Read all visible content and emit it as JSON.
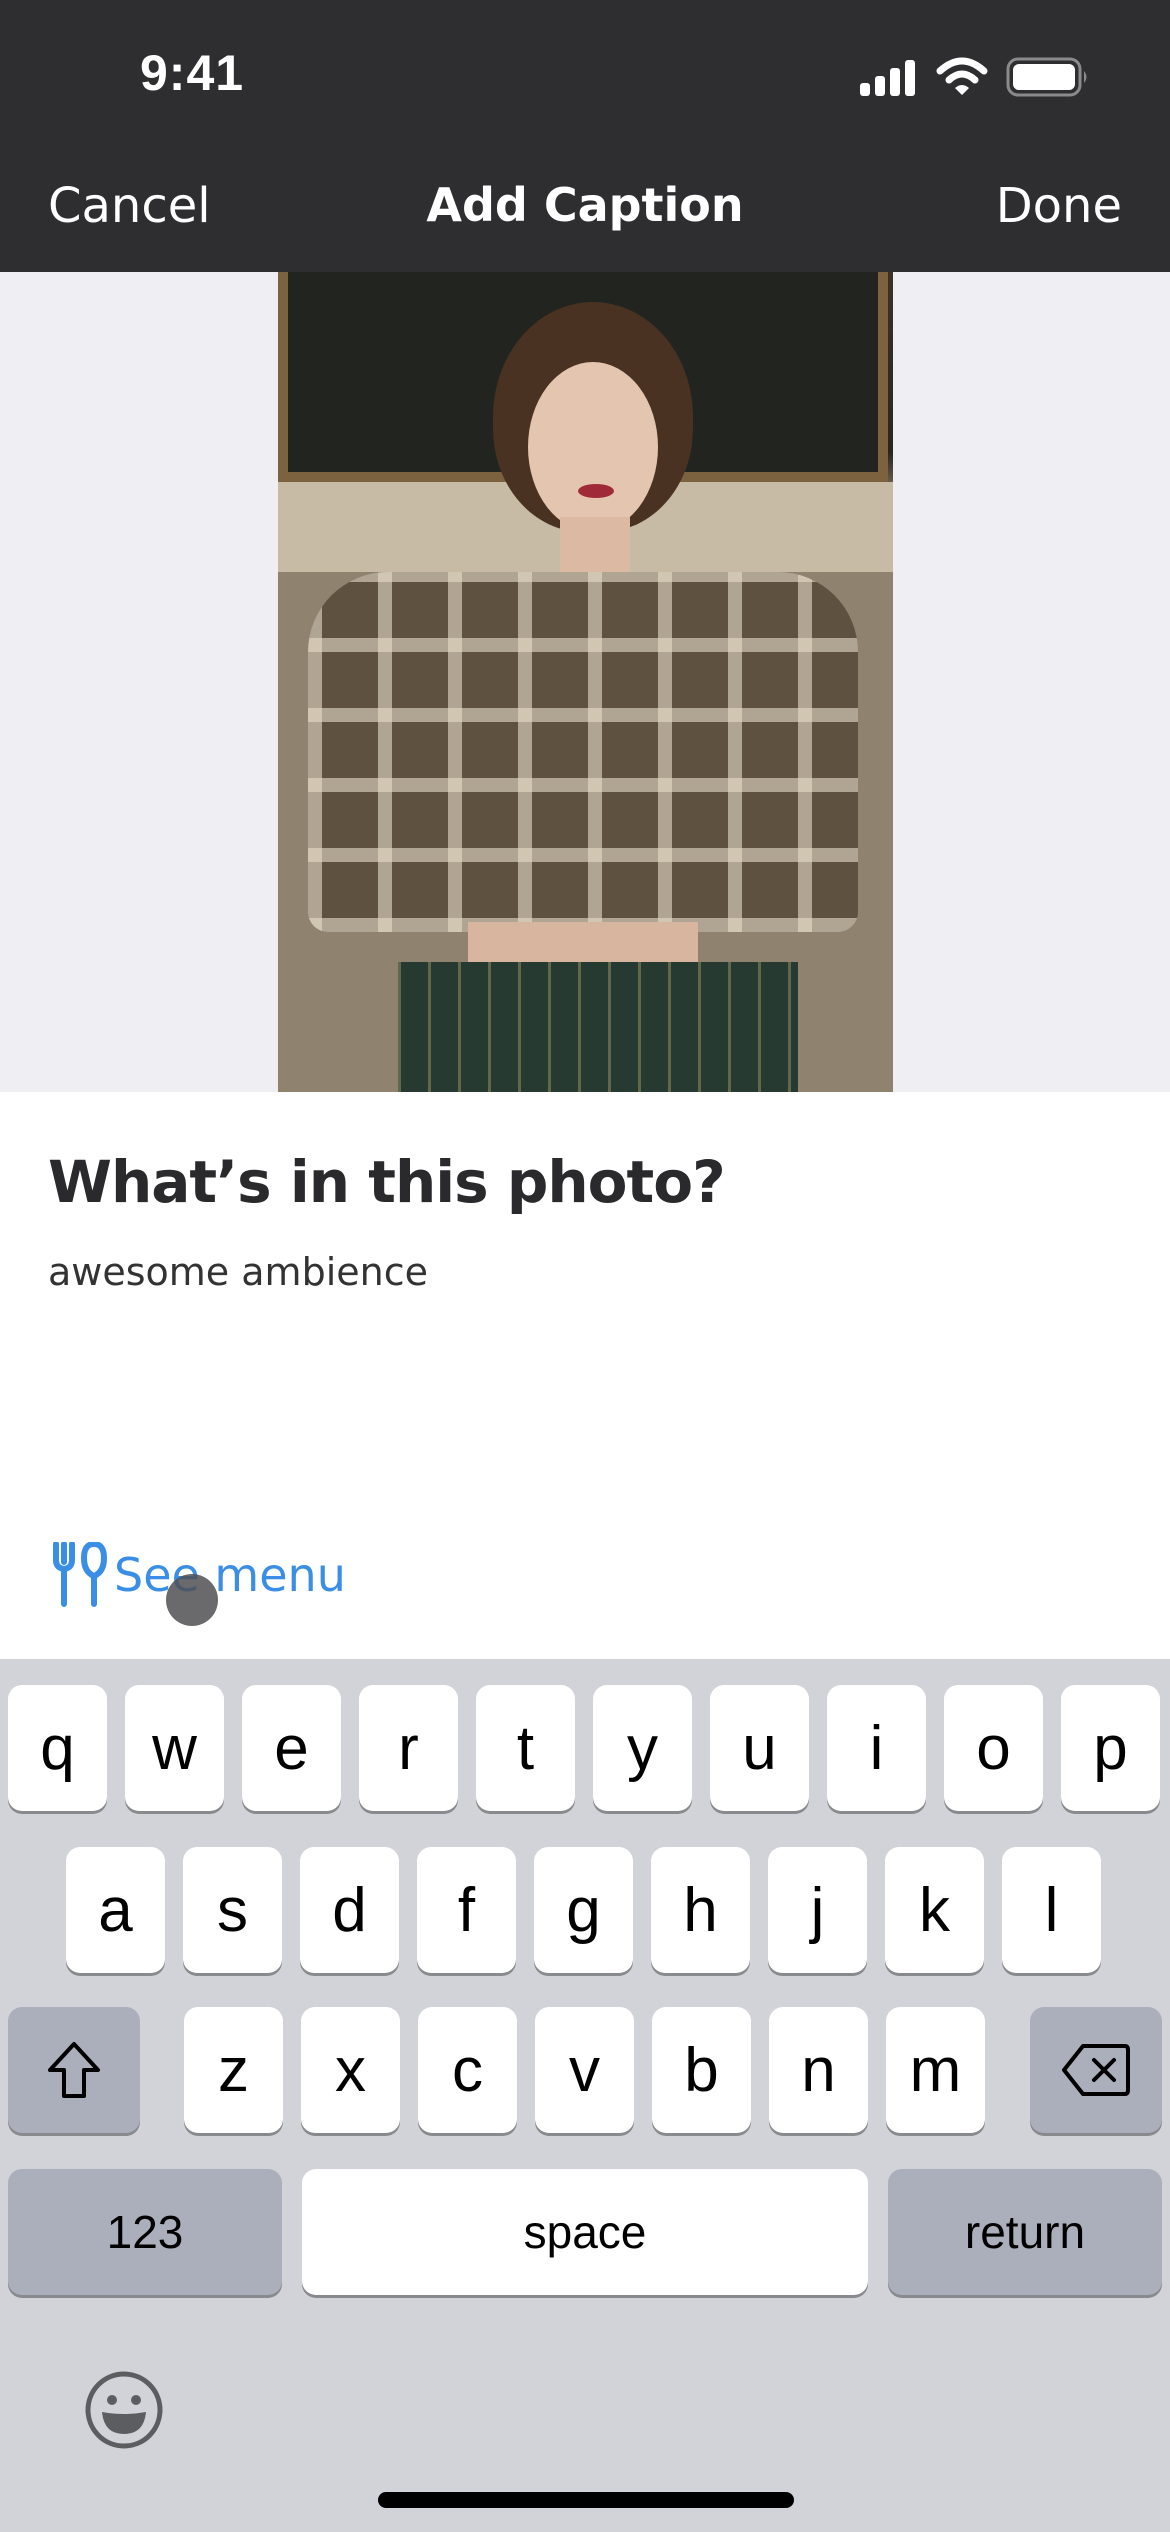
{
  "status_bar": {
    "time": "9:41",
    "icons": [
      "cellular-signal-icon",
      "wifi-icon",
      "battery-icon"
    ]
  },
  "nav": {
    "cancel_label": "Cancel",
    "title": "Add Caption",
    "done_label": "Done"
  },
  "photo": {
    "description": "Woman with short curly brown hair in a plaid shirt sitting on a beige sofa"
  },
  "content": {
    "question": "What’s in this photo?",
    "caption_value": "awesome ambience",
    "see_menu_label": "See menu",
    "see_menu_icon": "fork-knife-icon",
    "accent_color": "#3a8ee6"
  },
  "keyboard": {
    "row1": [
      "q",
      "w",
      "e",
      "r",
      "t",
      "y",
      "u",
      "i",
      "o",
      "p"
    ],
    "row2": [
      "a",
      "s",
      "d",
      "f",
      "g",
      "h",
      "j",
      "k",
      "l"
    ],
    "row3": [
      "z",
      "x",
      "c",
      "v",
      "b",
      "n",
      "m"
    ],
    "shift_icon": "shift-icon",
    "delete_icon": "delete-icon",
    "numbers_label": "123",
    "space_label": "space",
    "return_label": "return",
    "emoji_icon": "emoji-icon"
  }
}
